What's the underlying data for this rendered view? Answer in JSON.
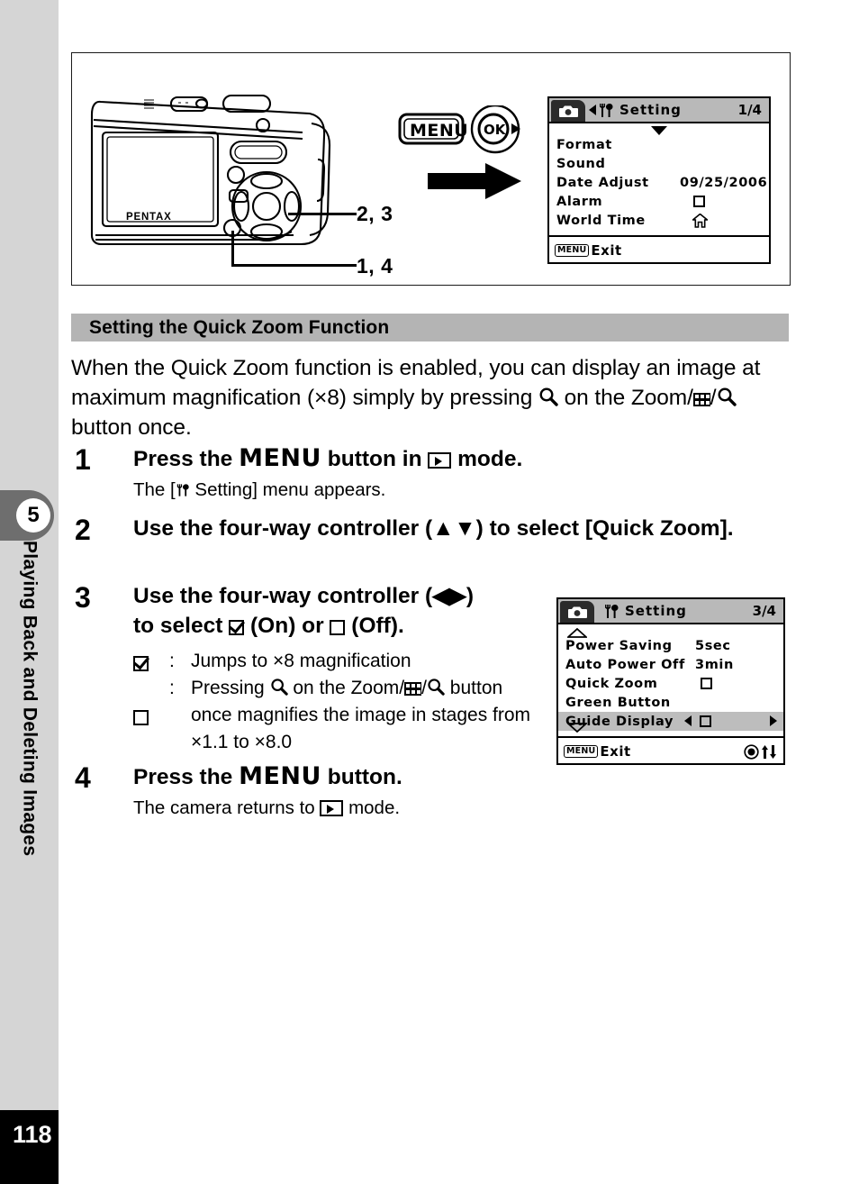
{
  "sidebar": {
    "chapter_number": "5",
    "chapter_title": "Playing Back and Deleting Images",
    "page_number": "118",
    "tab_color": "#6e6e6e",
    "background_color": "#d5d5d5"
  },
  "illustration": {
    "camera_brand": "PENTAX",
    "menu_button_label": "MENU",
    "ok_button_label": "OK",
    "callouts": [
      {
        "id": "callout-2-3",
        "label": "2, 3"
      },
      {
        "id": "callout-1-4",
        "label": "1, 4"
      }
    ]
  },
  "lcd_top": {
    "tab_icon": "camera-icon",
    "category_icon": "wrench-spanner-icon",
    "title": "Setting",
    "page_indicator": "1/4",
    "scroll_down": true,
    "rows": [
      {
        "label": "Format",
        "value": ""
      },
      {
        "label": "Sound",
        "value": ""
      },
      {
        "label": "Date Adjust",
        "value": "09/25/2006"
      },
      {
        "label": "Alarm",
        "value": "checkbox-off-icon"
      },
      {
        "label": "World Time",
        "value": "home-icon"
      }
    ],
    "footer": {
      "chip": "MENU",
      "label": "Exit"
    }
  },
  "lcd_bottom": {
    "tab_icon": "camera-icon",
    "category_icon": "wrench-spanner-icon",
    "title": "Setting",
    "page_indicator": "3/4",
    "scroll_up": true,
    "scroll_down": true,
    "rows": [
      {
        "label": "Power Saving",
        "value": "5sec",
        "highlight": false
      },
      {
        "label": "Auto Power Off",
        "value": "3min",
        "highlight": false
      },
      {
        "label": "Quick Zoom",
        "value": "checkbox-off-icon",
        "highlight": false
      },
      {
        "label": "Green Button",
        "value": "",
        "highlight": false
      },
      {
        "label": "Guide Display",
        "value": "checkbox-off-icon",
        "highlight": true,
        "left_arrow": true,
        "right_arrow": true
      }
    ],
    "footer": {
      "chip": "MENU",
      "label": "Exit",
      "icons": "ok-button-icon, up-down-arrows-icon"
    }
  },
  "section": {
    "header": "Setting the Quick Zoom Function",
    "header_bg": "#b4b4b4"
  },
  "intro": {
    "part1": "When the Quick Zoom function is enabled, you can display an image at maximum magnification (×8) simply by pressing ",
    "part2": " on the Zoom/",
    "part3": "/",
    "part4": " button once."
  },
  "steps": [
    {
      "number": "1",
      "head_part1": "Press the ",
      "head_menu": "MENU",
      "head_part2": " button in ",
      "head_part3": " mode.",
      "sub_part1": "The [",
      "sub_part2": " Setting] menu appears."
    },
    {
      "number": "2",
      "head_part1": "Use the four-way controller (",
      "head_arrows": "▲▼",
      "head_part2": ") to select [Quick Zoom]."
    },
    {
      "number": "3",
      "head_part1": "Use the four-way controller (",
      "head_arrows": "◀▶",
      "head_part2": ")",
      "head_line2_part1": "to select ",
      "head_line2_on": " (On) or ",
      "head_line2_off": " (Off).",
      "bullets": [
        {
          "symbol": "checkbox-on-icon",
          "colon": ":",
          "text": "Jumps to ×8 magnification"
        },
        {
          "symbol": "checkbox-off-icon",
          "colon": ":",
          "text_part1": "Pressing ",
          "text_part2": " on the Zoom/",
          "text_part3": "/",
          "text_part4": " button once magnifies the image in stages from ×1.1 to ×8.0"
        }
      ]
    },
    {
      "number": "4",
      "head_part1": "Press the ",
      "head_menu": "MENU",
      "head_part2": " button.",
      "sub_part1": "The camera returns to ",
      "sub_part2": " mode."
    }
  ]
}
